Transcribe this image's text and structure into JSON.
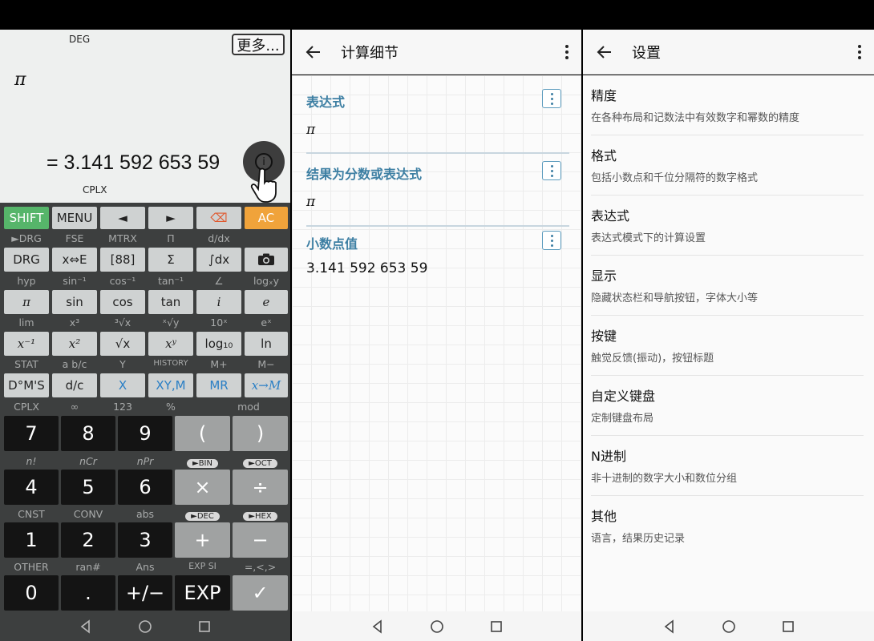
{
  "calculator": {
    "deg": "DEG",
    "more": "更多...",
    "expression": "π",
    "result": "= 3.141 592 653 59",
    "cplx_indicator": "CPLX",
    "info": "i",
    "rows": [
      {
        "labels": [
          "►DRG",
          "FSE",
          "MTRX",
          "Π",
          "d/dx",
          ""
        ]
      },
      {
        "labels": [
          "hyp",
          "sin⁻¹",
          "cos⁻¹",
          "tan⁻¹",
          "∠",
          "logₓy"
        ]
      },
      {
        "labels": [
          "lim",
          "x³",
          "³√x",
          "ˣ√y",
          "10ˣ",
          "eˣ"
        ]
      },
      {
        "labels": [
          "STAT",
          "a b/c",
          "Y",
          "HISTORY",
          "M+",
          "M−"
        ]
      },
      {
        "labels": [
          "CPLX",
          "∞",
          "123",
          "%",
          "mod",
          ""
        ]
      },
      {
        "labels": [
          "n!",
          "nCr",
          "nPr",
          "►BIN",
          "►OCT",
          ""
        ]
      },
      {
        "labels": [
          "CNST",
          "CONV",
          "abs",
          "►DEC",
          "►HEX",
          ""
        ]
      },
      {
        "labels": [
          "OTHER",
          "ran#",
          "Ans",
          "EXP SI",
          "=,<,>",
          ""
        ]
      }
    ],
    "keys": {
      "r0": [
        "SHIFT",
        "MENU",
        "◄",
        "►",
        "⌫",
        "AC"
      ],
      "r1": [
        "DRG",
        "x⇔E",
        "[88]",
        "Σ",
        "∫dx",
        "📷"
      ],
      "r2": [
        "π",
        "sin",
        "cos",
        "tan",
        "i",
        "e"
      ],
      "r3": [
        "x⁻¹",
        "x²",
        "√x",
        "xʸ",
        "log₁₀",
        "ln"
      ],
      "r4": [
        "D°M'S",
        "d/c",
        "X",
        "XY,M",
        "MR",
        "x→M"
      ],
      "r5": [
        "7",
        "8",
        "9",
        "(",
        ")"
      ],
      "r6": [
        "4",
        "5",
        "6",
        "×",
        "÷"
      ],
      "r7": [
        "1",
        "2",
        "3",
        "+",
        "−"
      ],
      "r8": [
        "0",
        ".",
        "+/−",
        "EXP",
        "✓"
      ]
    }
  },
  "detail": {
    "title": "计算细节",
    "sections": [
      {
        "title": "表达式",
        "value": "π"
      },
      {
        "title": "结果为分数或表达式",
        "value": "π"
      },
      {
        "title": "小数点值",
        "value": "3.141 592 653 59"
      }
    ]
  },
  "settings": {
    "title": "设置",
    "items": [
      {
        "title": "精度",
        "desc": "在各种布局和记数法中有效数字和幂数的精度"
      },
      {
        "title": "格式",
        "desc": "包括小数点和千位分隔符的数字格式"
      },
      {
        "title": "表达式",
        "desc": "表达式模式下的计算设置"
      },
      {
        "title": "显示",
        "desc": "隐藏状态栏和导航按钮，字体大小等"
      },
      {
        "title": "按键",
        "desc": "触觉反馈(振动)，按钮标题"
      },
      {
        "title": "自定义键盘",
        "desc": "定制键盘布局"
      },
      {
        "title": "N进制",
        "desc": "非十进制的数字大小和数位分组"
      },
      {
        "title": "其他",
        "desc": "语言，结果历史记录"
      }
    ]
  },
  "colors": {
    "accent": "#3d7fa3",
    "shift": "#56b56a",
    "ac": "#f0a33b"
  }
}
